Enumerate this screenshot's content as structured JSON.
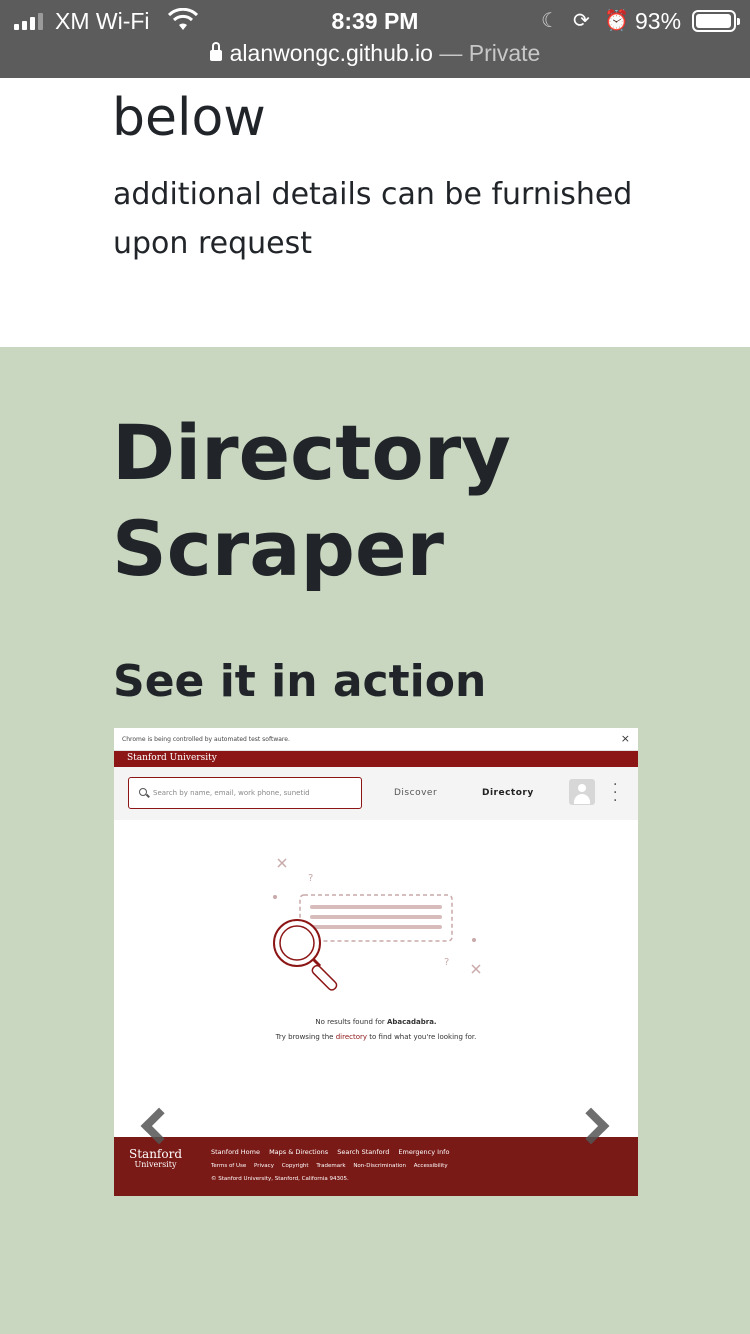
{
  "status_bar": {
    "carrier": "XM Wi-Fi",
    "time": "8:39 PM",
    "battery_percent": "93%",
    "battery_level": 0.93,
    "url": "alanwongc.github.io",
    "url_separator": "—",
    "private_label": "Private"
  },
  "top_section": {
    "heading_tail": "below",
    "details": "additional details can be furnished upon request"
  },
  "project": {
    "title": "Directory Scraper",
    "subheading": "See it in action"
  },
  "carousel": {
    "slide": {
      "chrome_notice": "Chrome is being controlled by automated test software.",
      "close_glyph": "×",
      "brand_bar": "Stanford University",
      "search_placeholder": "Search by name, email, work phone, sunetid",
      "nav": [
        "Discover",
        "Directory"
      ],
      "no_results_prefix": "No results found for",
      "no_results_query": "Abacadabra.",
      "try_prefix": "Try browsing the",
      "try_link": "directory",
      "try_suffix": "to find what you're looking for.",
      "footer_logo": "Stanford",
      "footer_logo_sub": "University",
      "footer_links_1": [
        "Stanford Home",
        "Maps & Directions",
        "Search Stanford",
        "Emergency Info"
      ],
      "footer_links_2": [
        "Terms of Use",
        "Privacy",
        "Copyright",
        "Trademark",
        "Non-Discrimination",
        "Accessibility"
      ],
      "footer_copy": "© Stanford University, Stanford, California 94305."
    },
    "prev_icon": "chevron-left-icon",
    "next_icon": "chevron-right-icon"
  },
  "colors": {
    "status_bar_bg": "#5c5c5c",
    "section_green": "#c9d6c0",
    "stanford_red": "#8c1515",
    "footer_red": "#7a1a17"
  }
}
